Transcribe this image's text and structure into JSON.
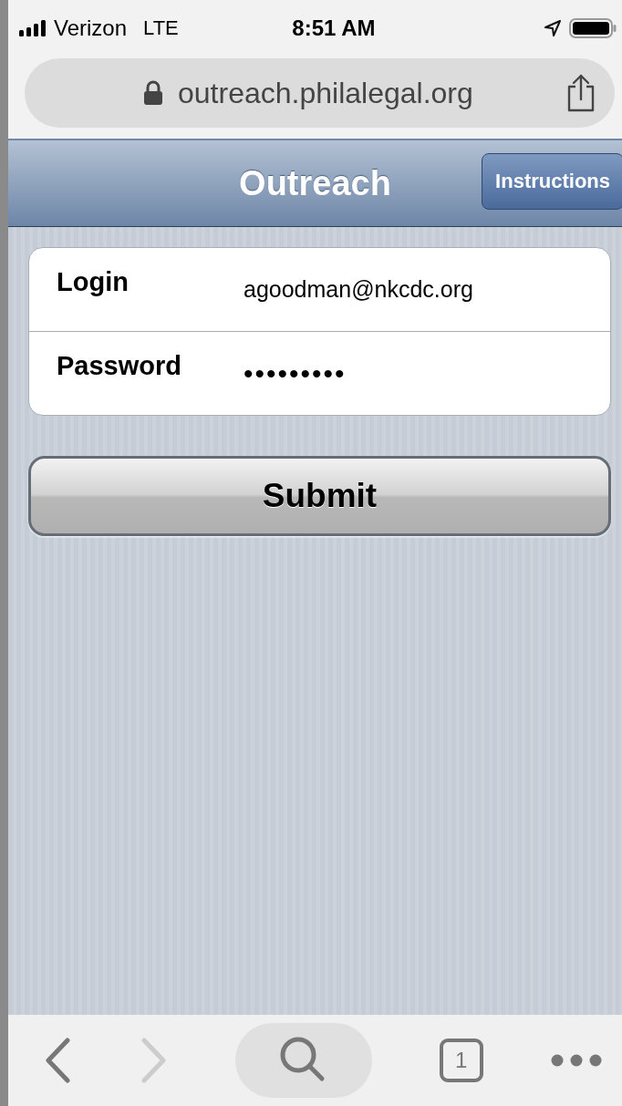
{
  "status_bar": {
    "carrier": "Verizon",
    "network": "LTE",
    "time": "8:51 AM"
  },
  "address_bar": {
    "url": "outreach.philalegal.org"
  },
  "header": {
    "title": "Outreach",
    "button": "Instructions"
  },
  "form": {
    "fields": [
      {
        "label": "Login",
        "value": "agoodman@nkcdc.org",
        "kind": "text"
      },
      {
        "label": "Password",
        "value": "•••••••••",
        "kind": "password"
      }
    ],
    "submit": "Submit"
  },
  "toolbar": {
    "back_disabled": false,
    "forward_disabled": true,
    "tab_count": "1"
  }
}
